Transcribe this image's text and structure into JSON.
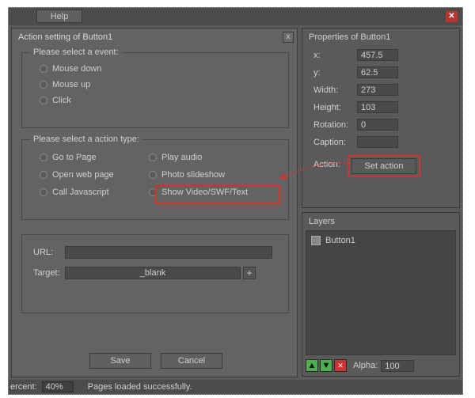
{
  "topbar": {
    "help": "Help"
  },
  "dialog": {
    "title": "Action setting of Button1",
    "event_label": "Please select a event:",
    "events": [
      "Mouse down",
      "Mouse up",
      "Click"
    ],
    "action_label": "Please select a action type:",
    "actions_col1": [
      "Go to Page",
      "Open web page",
      "Call Javascript"
    ],
    "actions_col2": [
      "Play audio",
      "Photo slideshow",
      "Show Video/SWF/Text"
    ],
    "url_label": "URL:",
    "url_value": "",
    "target_label": "Target:",
    "target_value": "_blank",
    "save": "Save",
    "cancel": "Cancel"
  },
  "props": {
    "title": "Properties of Button1",
    "x_label": "x:",
    "x": "457.5",
    "y_label": "y:",
    "y": "62.5",
    "w_label": "Width:",
    "w": "273",
    "h_label": "Height:",
    "h": "103",
    "r_label": "Rotation:",
    "r": "0",
    "c_label": "Caption:",
    "c": "",
    "a_label": "Action:",
    "set_action": "Set action"
  },
  "layers": {
    "title": "Layers",
    "item": "Button1",
    "alpha_label": "Alpha:",
    "alpha": "100"
  },
  "status": {
    "percent_label": "ercent:",
    "percent": "40%",
    "msg": "Pages loaded successfully."
  }
}
